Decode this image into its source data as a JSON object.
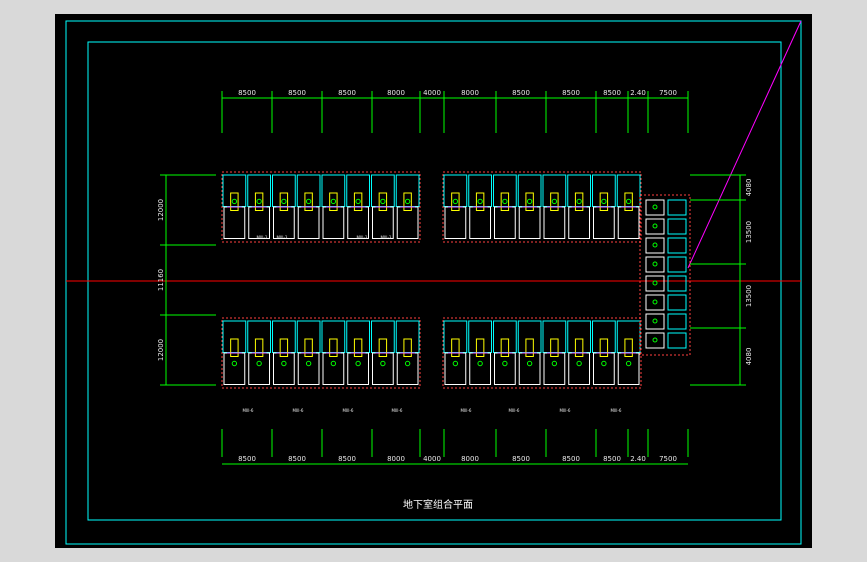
{
  "drawing": {
    "title": "地下室组合平面",
    "colors": {
      "background": "#000000",
      "frame": "#00ffff",
      "axis": "#ff0000",
      "dimension": "#00ff00",
      "wall": "#ffffff",
      "room_fill": "#ffff00",
      "diagonal": "#ff00ff"
    },
    "dimensions": {
      "top": [
        "8500",
        "8500",
        "8500",
        "8000",
        "4000",
        "8000",
        "8500",
        "8500",
        "8500",
        "2.40",
        "7500"
      ],
      "bottom": [
        "8500",
        "8500",
        "8500",
        "8000",
        "4000",
        "8000",
        "8500",
        "8500",
        "8500",
        "2.40",
        "7500"
      ],
      "left": [
        "12000",
        "11160",
        "12000"
      ],
      "right": [
        "4080",
        "13500",
        "13500",
        "4080"
      ]
    },
    "unit_labels_upper": [
      "MIII-3",
      "MIII-3",
      "MIII-3",
      "MIII-3"
    ],
    "unit_labels_lower": [
      "MIII-6",
      "MIII-6",
      "MIII-6",
      "MIII-6",
      "MIII-6",
      "MIII-6",
      "MIII-6",
      "MIII-6"
    ]
  }
}
